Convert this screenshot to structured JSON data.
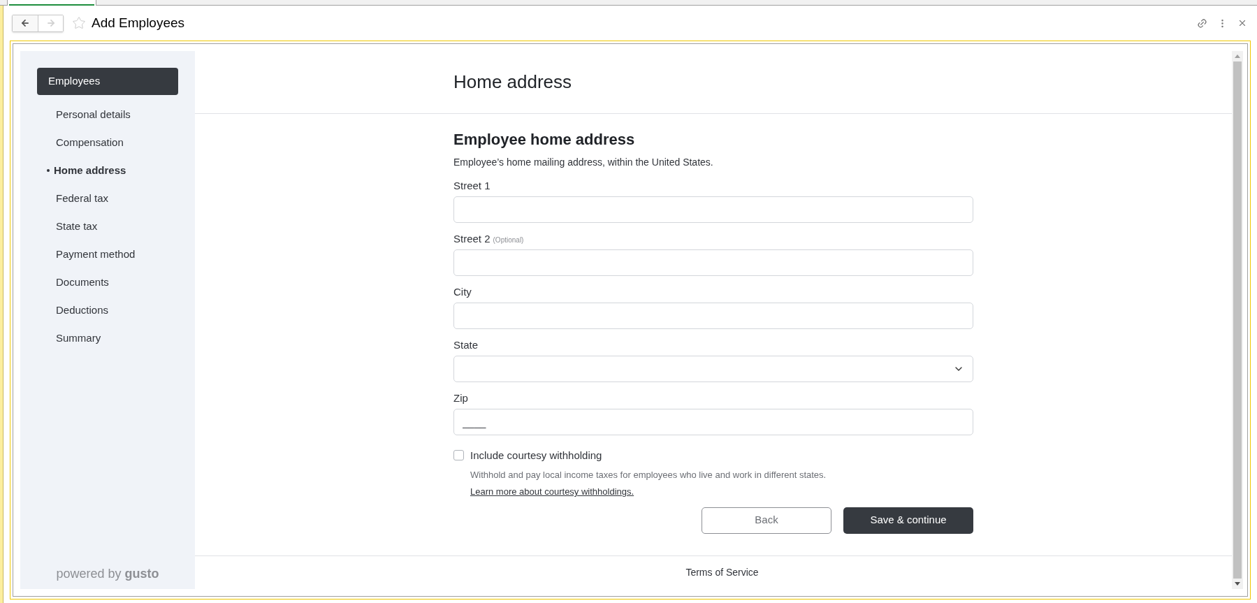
{
  "header": {
    "title": "Add Employees",
    "nav_buttons": [
      {
        "kind": "back",
        "disabled": false
      },
      {
        "kind": "forward",
        "disabled": true
      }
    ]
  },
  "sidebar": {
    "heading": "Employees",
    "items": [
      {
        "label": "Personal details",
        "selected": false
      },
      {
        "label": "Compensation",
        "selected": false
      },
      {
        "label": "Home address",
        "selected": true
      },
      {
        "label": "Federal tax",
        "selected": false
      },
      {
        "label": "State tax",
        "selected": false
      },
      {
        "label": "Payment method",
        "selected": false
      },
      {
        "label": "Documents",
        "selected": false
      },
      {
        "label": "Deductions",
        "selected": false
      },
      {
        "label": "Summary",
        "selected": false
      }
    ],
    "footer": "powered by **gusto**"
  },
  "main": {
    "title": "Home address",
    "section": {
      "title": "Employee home address",
      "description": "Employee’s home mailing address, within the United States.",
      "fields": [
        {
          "kind": "text",
          "label": "Street 1"
        },
        {
          "kind": "text",
          "label": "Street 2",
          "note": "(Optional)"
        },
        {
          "kind": "text",
          "label": "City"
        },
        {
          "kind": "select",
          "label": "State"
        },
        {
          "kind": "text",
          "label": "Zip",
          "placeholder": "____"
        }
      ],
      "checkbox": {
        "label": "Include courtesy withholding",
        "checked": false,
        "description": "Withhold and pay local income taxes for employees who live and work in different states.",
        "link": "Learn more about courtesy withholdings."
      }
    },
    "buttons": [
      {
        "kind": "secondary",
        "label": "Back"
      },
      {
        "kind": "primary",
        "label": "Save & continue"
      }
    ],
    "footer_link": "Terms of Service"
  }
}
